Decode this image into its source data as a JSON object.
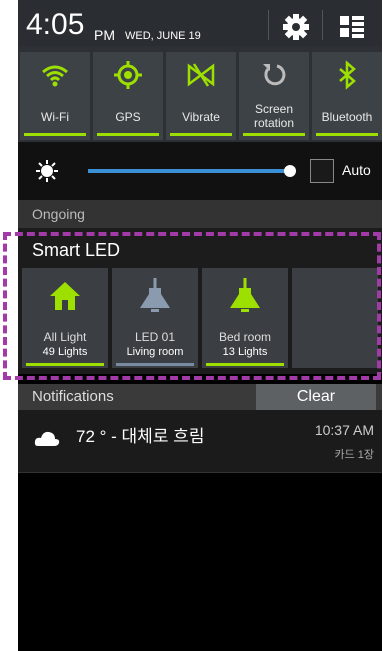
{
  "status_bar": {
    "time": "4:05",
    "ampm": "PM",
    "date": "WED, JUNE 19",
    "settings_icon": "gear-icon",
    "apps_icon": "grid-toggle-icon"
  },
  "quick_toggles": [
    {
      "label": "Wi-Fi",
      "icon": "wifi-icon",
      "active": true
    },
    {
      "label": "GPS",
      "icon": "gps-icon",
      "active": true
    },
    {
      "label": "Vibrate",
      "icon": "vibrate-icon",
      "active": true
    },
    {
      "label_line1": "Screen",
      "label_line2": "rotation",
      "icon": "rotation-icon",
      "active": false
    },
    {
      "label": "Bluetooth",
      "icon": "bluetooth-icon",
      "active": true
    }
  ],
  "brightness": {
    "icon": "sun-icon",
    "auto_label": "Auto",
    "level": 0.98
  },
  "ongoing": {
    "label": "Ongoing"
  },
  "smart_led": {
    "title": "Smart LED",
    "tiles": [
      {
        "line1": "All Light",
        "line2": "49 Lights",
        "icon": "home-icon",
        "active": true
      },
      {
        "line1": "LED 01",
        "line2": "Living room",
        "icon": "pendant-lamp-icon",
        "active": false
      },
      {
        "line1": "Bed room",
        "line2": "13 Lights",
        "icon": "pendant-lamp-icon",
        "active": true
      }
    ]
  },
  "notifications": {
    "header": "Notifications",
    "clear_label": "Clear",
    "items": [
      {
        "text": "72 ° - 대체로 흐림",
        "time": "10:37 AM",
        "sub": "카드 1장",
        "icon": "cloud-icon"
      }
    ]
  },
  "colors": {
    "accent": "#9de000",
    "slider": "#3b8fd5",
    "highlight": "#a23aa8"
  }
}
